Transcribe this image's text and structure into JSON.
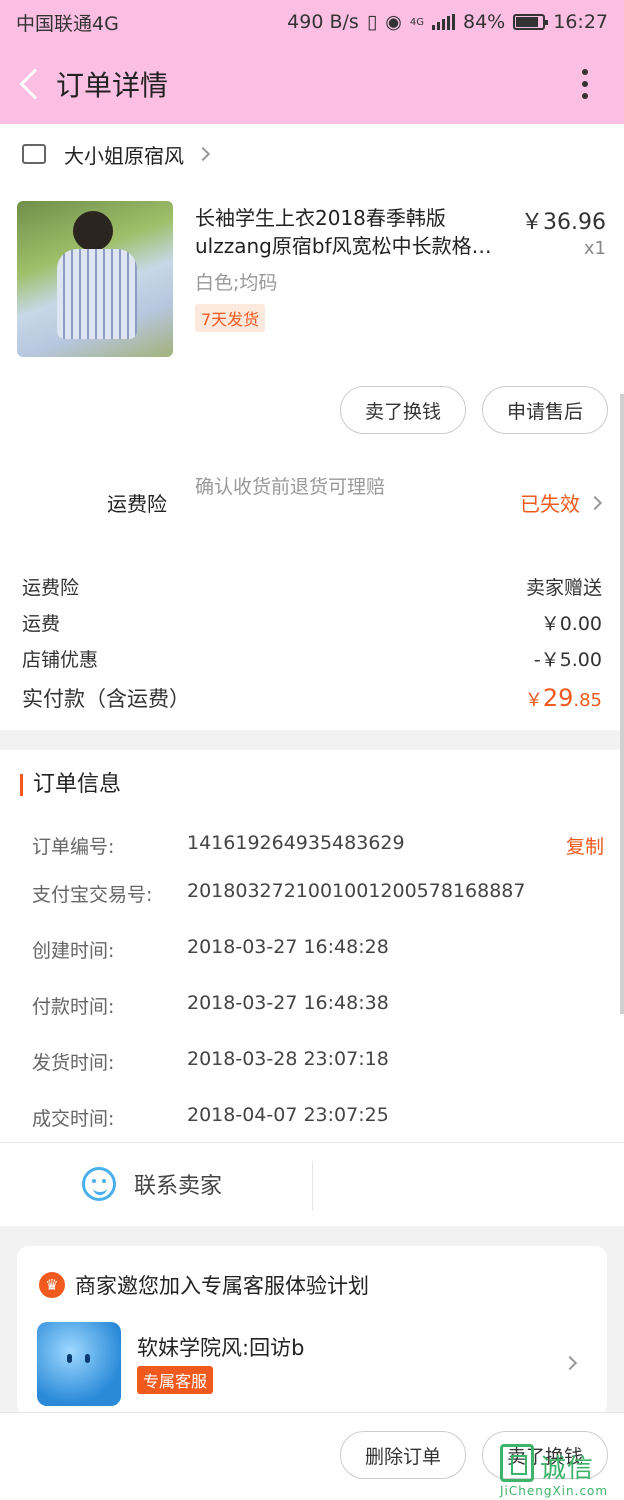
{
  "status_bar": {
    "carrier": "中国联通4G",
    "net_speed": "490 B/s",
    "signal_label": "4G",
    "battery": "84%",
    "battery_level": 0.84,
    "time": "16:27"
  },
  "header": {
    "title": "订单详情"
  },
  "shop": {
    "name": "大小姐原宿风"
  },
  "product": {
    "title": "长袖学生上衣2018春季韩版ulzzang原宿bf风宽松中长款格…",
    "price": "￥36.96",
    "qty": "x1",
    "sku": "白色;均码",
    "tag": "7天发货"
  },
  "actions": {
    "resell": "卖了换钱",
    "after_sale": "申请售后"
  },
  "insurance": {
    "label": "运费险",
    "desc": "确认收货前退货可理赔",
    "status": "已失效"
  },
  "fees": [
    {
      "label": "运费险",
      "value": "卖家赠送"
    },
    {
      "label": "运费",
      "value": "￥0.00"
    },
    {
      "label": "店铺优惠",
      "value": "-￥5.00"
    }
  ],
  "total": {
    "label": "实付款（含运费）",
    "currency": "￥",
    "int": "29",
    "dec": ".85"
  },
  "order_info": {
    "title": "订单信息",
    "copy_label": "复制",
    "rows": [
      {
        "k": "订单编号:",
        "v": "141619264935483629"
      },
      {
        "k": "支付宝交易号:",
        "v": "2018032721001001200578168887"
      },
      {
        "k": "创建时间:",
        "v": "2018-03-27 16:48:28"
      },
      {
        "k": "付款时间:",
        "v": "2018-03-27 16:48:38"
      },
      {
        "k": "发货时间:",
        "v": "2018-03-28 23:07:18"
      },
      {
        "k": "成交时间:",
        "v": "2018-04-07 23:07:25"
      }
    ]
  },
  "contact": {
    "label": "联系卖家"
  },
  "service_card": {
    "title": "商家邀您加入专属客服体验计划",
    "crown": "♛",
    "name": "软妹学院风:回访b",
    "tag": "专属客服"
  },
  "bottom": {
    "delete": "删除订单",
    "resell": "卖了换钱"
  },
  "watermark": {
    "text": "诚信",
    "sub": "JiChengXin.com"
  },
  "colors": {
    "header_bg": "#fbbfe3",
    "accent": "#f05a1e",
    "link_blue": "#4ab0ec"
  }
}
